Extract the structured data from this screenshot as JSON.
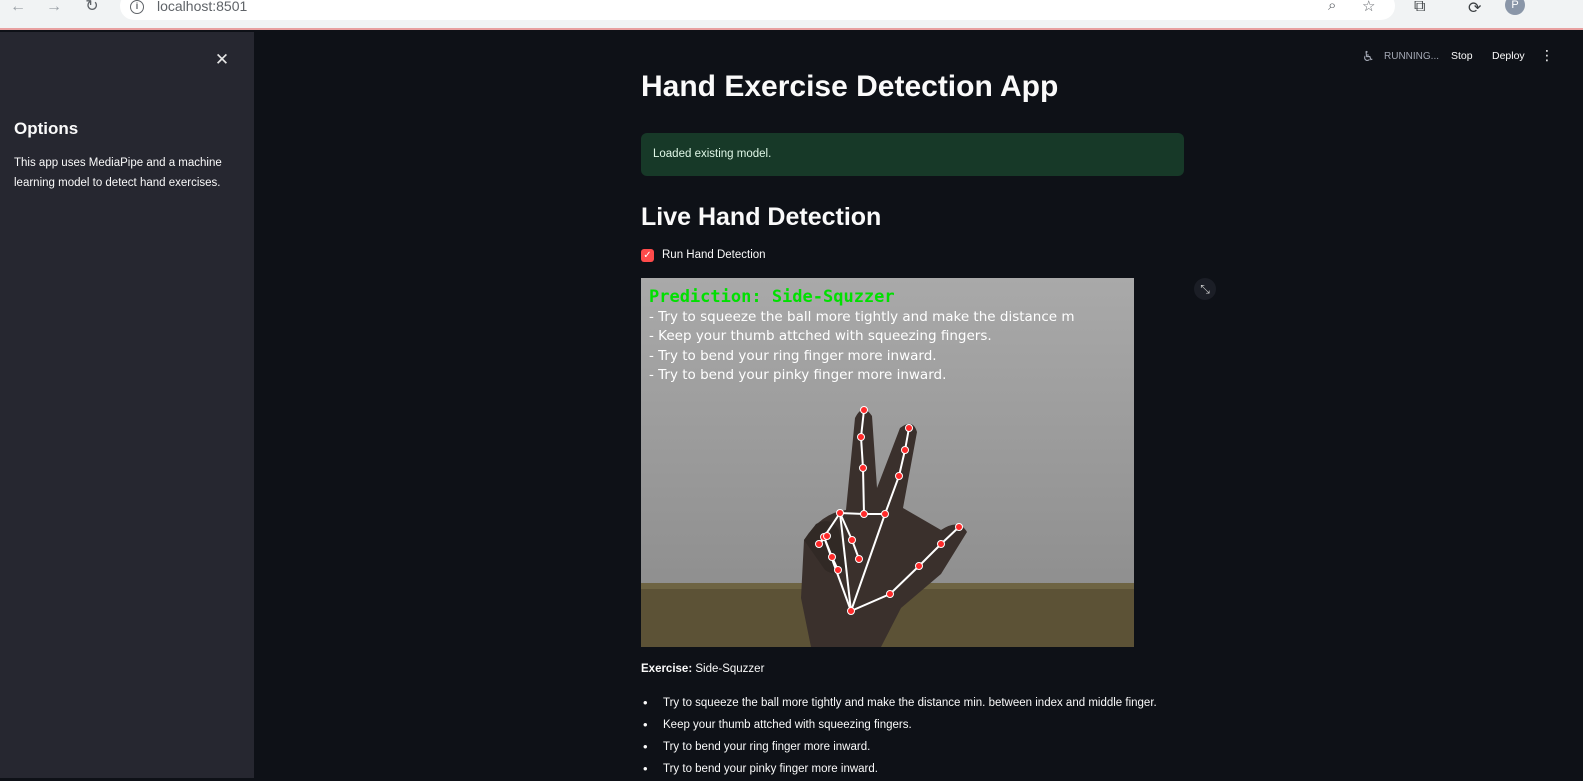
{
  "browser": {
    "url": "localhost:8501",
    "profile_initial": "P"
  },
  "sidebar": {
    "heading": "Options",
    "description": "This app uses MediaPipe and a machine learning model to detect hand exercises."
  },
  "toolbar": {
    "status": "RUNNING...",
    "stop_label": "Stop",
    "deploy_label": "Deploy"
  },
  "main": {
    "title": "Hand Exercise Detection App",
    "alert": "Loaded existing model.",
    "subtitle": "Live Hand Detection",
    "checkbox_label": "Run Hand Detection",
    "checkbox_checked": true,
    "video_overlay": {
      "prediction": "Prediction: Side-Squzzer",
      "lines": [
        "- Try to squeeze the ball more tightly and make the distance m",
        "- Keep your thumb attched with squeezing fingers.",
        "- Try to bend your ring finger more inward.",
        "- Try to bend your pinky finger more inward."
      ]
    },
    "exercise_label": "Exercise:",
    "exercise_value": "Side-Squzzer",
    "tips": [
      "Try to squeeze the ball more tightly and make the distance min. between index and middle finger.",
      "Keep your thumb attched with squeezing fingers.",
      "Try to bend your ring finger more inward.",
      "Try to bend your pinky finger more inward."
    ]
  },
  "colors": {
    "accent": "#ff4b4b",
    "success_bg": "#173928",
    "prediction_text": "#00e000",
    "landmark": "#ff2a2a"
  }
}
